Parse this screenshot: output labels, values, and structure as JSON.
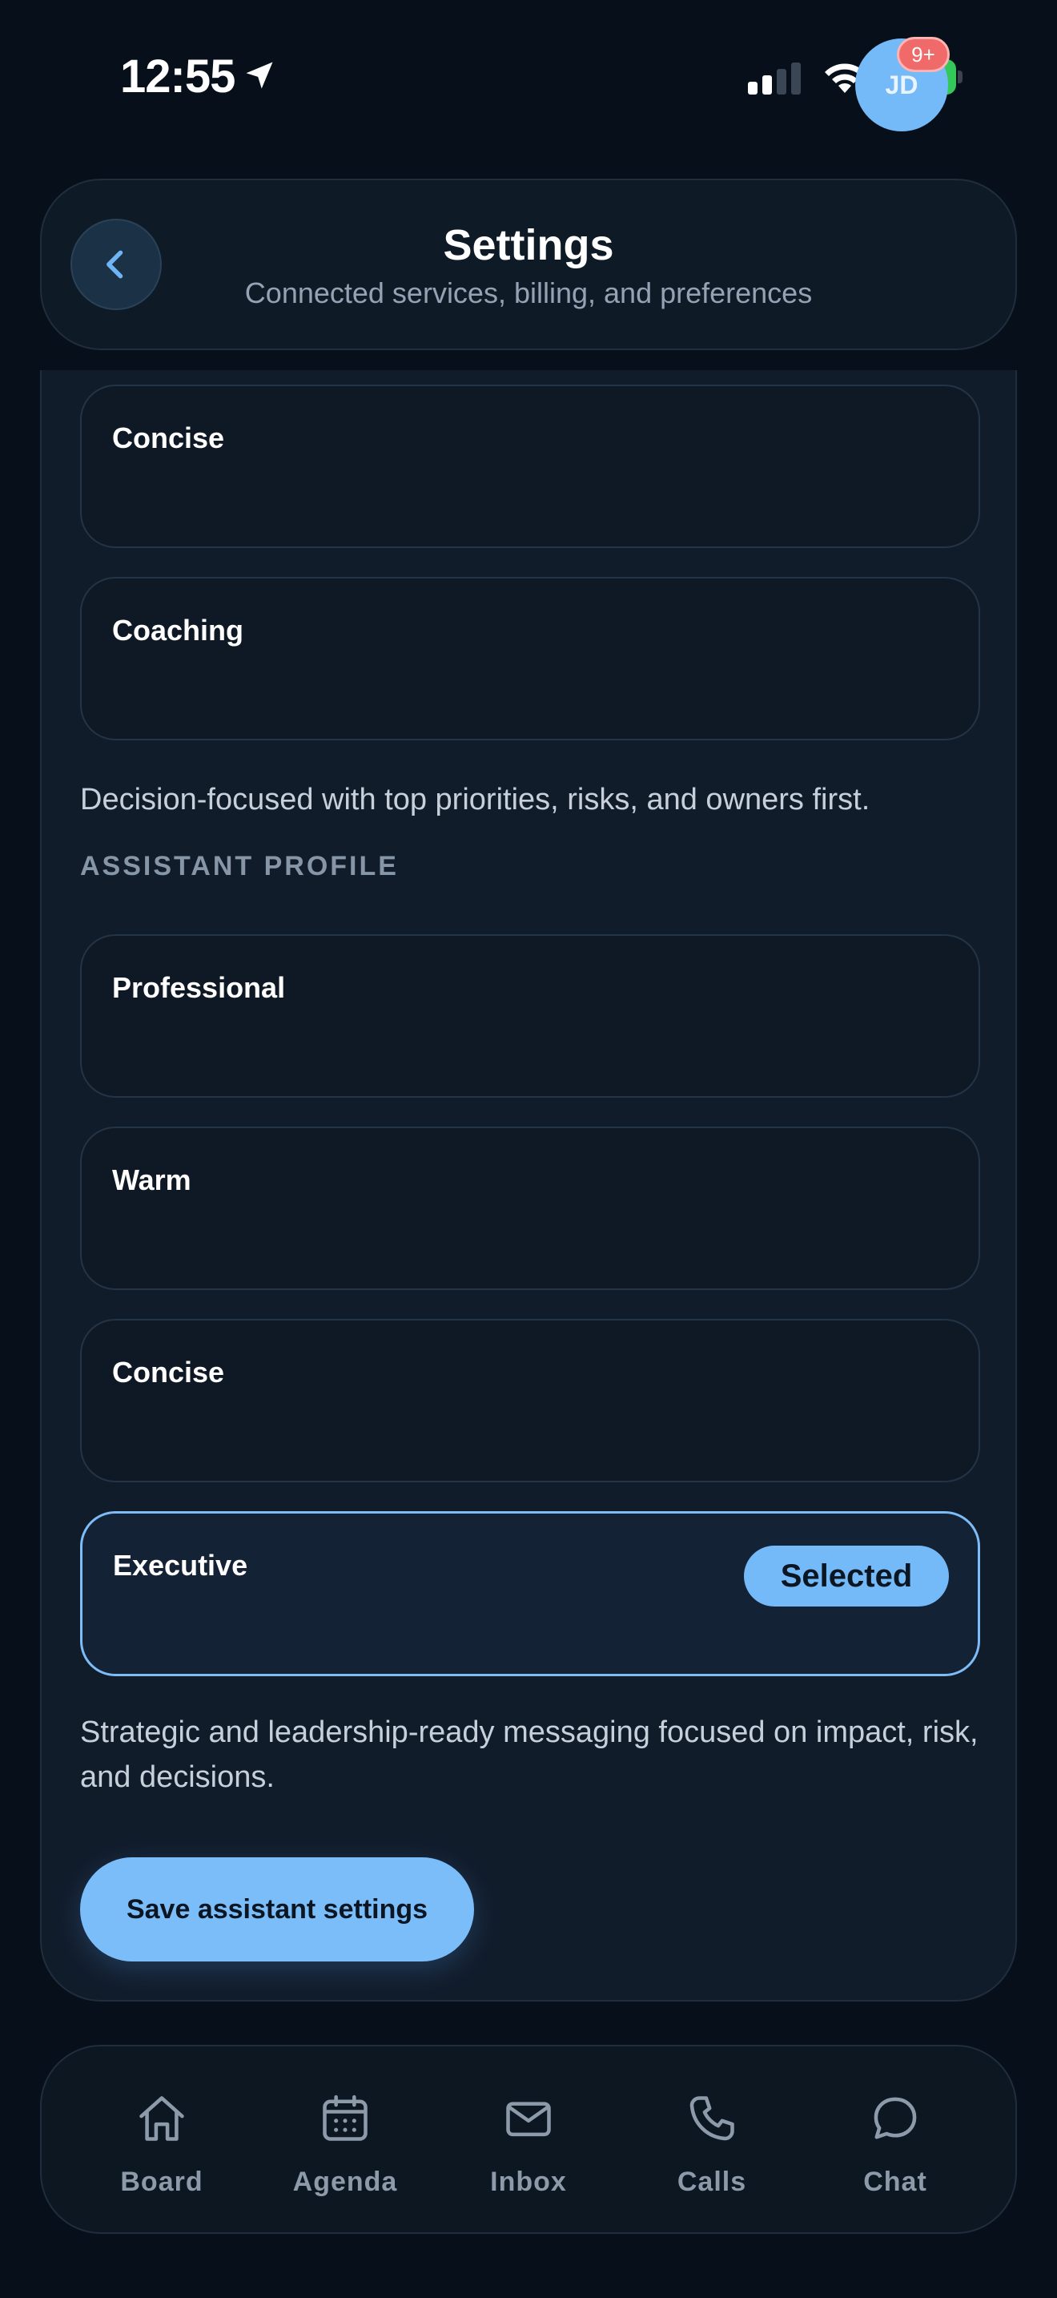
{
  "status_bar": {
    "time": "12:55",
    "battery": "97"
  },
  "header": {
    "title": "Settings",
    "subtitle": "Connected services, billing, and preferences",
    "avatar_initials": "JD",
    "notification_count": "9+"
  },
  "summary_style": {
    "options": [
      {
        "label": "Concise"
      },
      {
        "label": "Coaching"
      }
    ],
    "description": "Decision-focused with top priorities, risks, and owners first."
  },
  "assistant_profile": {
    "heading": "ASSISTANT PROFILE",
    "options": [
      {
        "label": "Professional"
      },
      {
        "label": "Warm"
      },
      {
        "label": "Concise"
      },
      {
        "label": "Executive",
        "badge": "Selected"
      }
    ],
    "description": "Strategic and leadership-ready messaging focused on impact, risk, and decisions."
  },
  "save_label": "Save assistant settings",
  "nav": {
    "items": [
      {
        "label": "Board",
        "icon": "home-icon"
      },
      {
        "label": "Agenda",
        "icon": "calendar-icon"
      },
      {
        "label": "Inbox",
        "icon": "mail-icon"
      },
      {
        "label": "Calls",
        "icon": "phone-icon"
      },
      {
        "label": "Chat",
        "icon": "chat-bubble-icon"
      }
    ]
  },
  "colors": {
    "background": "#07101a",
    "card": "#111c2b",
    "accent": "#74b9f8",
    "badge": "#f06a6a",
    "battery": "#34c759"
  }
}
